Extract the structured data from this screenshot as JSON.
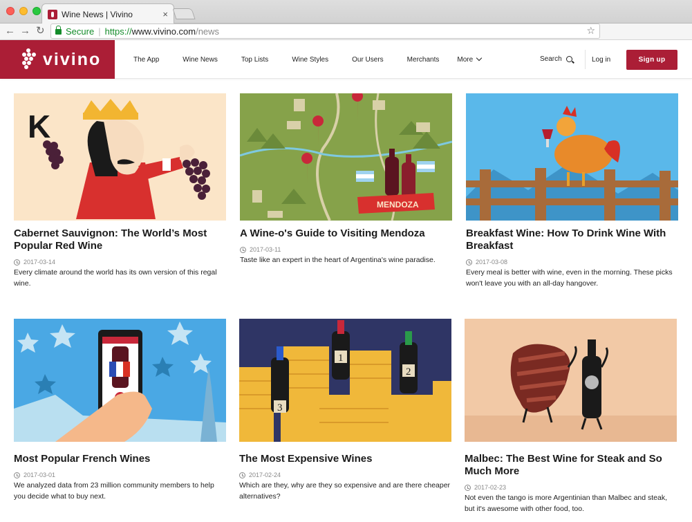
{
  "browser": {
    "tab_title": "Wine News | Vivino",
    "tab_close": "×",
    "back": "←",
    "forward": "→",
    "reload": "↻",
    "secure_label": "Secure",
    "url_scheme": "https://",
    "url_host": "www.vivino.com",
    "url_path": "/news",
    "bookmark_icon": "☆"
  },
  "header": {
    "logo_text": "vivino",
    "nav": [
      "The App",
      "Wine News",
      "Top Lists",
      "Wine Styles",
      "Our Users",
      "Merchants"
    ],
    "more_label": "More",
    "search_label": "Search",
    "login_label": "Log in",
    "signup_label": "Sign up",
    "brand_color": "#ab1e36"
  },
  "articles": [
    {
      "title": "Cabernet Sauvignon: The World’s Most Popular Red Wine",
      "date": "2017-03-14",
      "excerpt": "Every climate around the world has its own version of this regal wine.",
      "image_letter": "K"
    },
    {
      "title": "A Wine-o's Guide to Visiting Mendoza",
      "date": "2017-03-11",
      "excerpt": "Taste like an expert in the heart of Argentina's wine paradise.",
      "image_banner": "MENDOZA"
    },
    {
      "title": "Breakfast Wine: How To Drink Wine With Breakfast",
      "date": "2017-03-08",
      "excerpt": "Every meal is better with wine, even in the morning. These picks won't leave you with an all-day hangover."
    },
    {
      "title": "Most Popular French Wines",
      "date": "2017-03-01",
      "excerpt": "We analyzed data from 23 million community members to help you decide what to buy next."
    },
    {
      "title": "The Most Expensive Wines",
      "date": "2017-02-24",
      "excerpt": "Which are they, why are they so expensive and are there cheaper alternatives?",
      "image_labels": [
        "1",
        "2",
        "3"
      ]
    },
    {
      "title": "Malbec: The Best Wine for Steak and So Much More",
      "date": "2017-02-23",
      "excerpt": "Not even the tango is more Argentinian than Malbec and steak, but it's awesome with other food, too."
    }
  ]
}
